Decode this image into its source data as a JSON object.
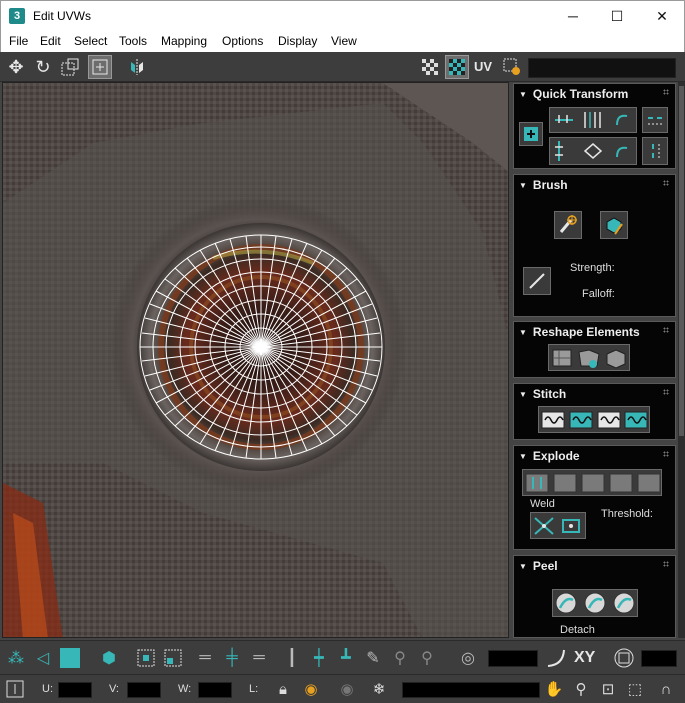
{
  "window": {
    "title": "Edit UVWs",
    "app_icon": "3",
    "minimize": "─",
    "maximize": "☐",
    "close": "✕"
  },
  "menu": {
    "items": [
      "File",
      "Edit",
      "Select",
      "Tools",
      "Mapping",
      "Options",
      "Display",
      "View"
    ]
  },
  "toolbar": {
    "uv_label": "UV",
    "icons": [
      "move-icon",
      "rotate-icon",
      "scale-icon",
      "freeform-icon",
      "mirror-icon",
      "checker-icon",
      "checker-pattern-icon",
      "uv-icon",
      "settings-icon"
    ]
  },
  "panels": {
    "quick_transform": {
      "title": "Quick Transform"
    },
    "brush": {
      "title": "Brush",
      "strength_label": "Strength:",
      "falloff_label": "Falloff:"
    },
    "reshape": {
      "title": "Reshape Elements"
    },
    "stitch": {
      "title": "Stitch"
    },
    "explode": {
      "title": "Explode",
      "weld_label": "Weld",
      "threshold_label": "Threshold:"
    },
    "peel": {
      "title": "Peel",
      "detach_label": "Detach"
    }
  },
  "bottom_toolbar": {
    "xy_label": "XY"
  },
  "status": {
    "u_label": "U:",
    "v_label": "V:",
    "w_label": "W:",
    "l_label": "L:"
  },
  "colors": {
    "accent": "#37b7b7",
    "panel_bg": "#050505",
    "toolbar_bg": "#3d3d3d"
  }
}
